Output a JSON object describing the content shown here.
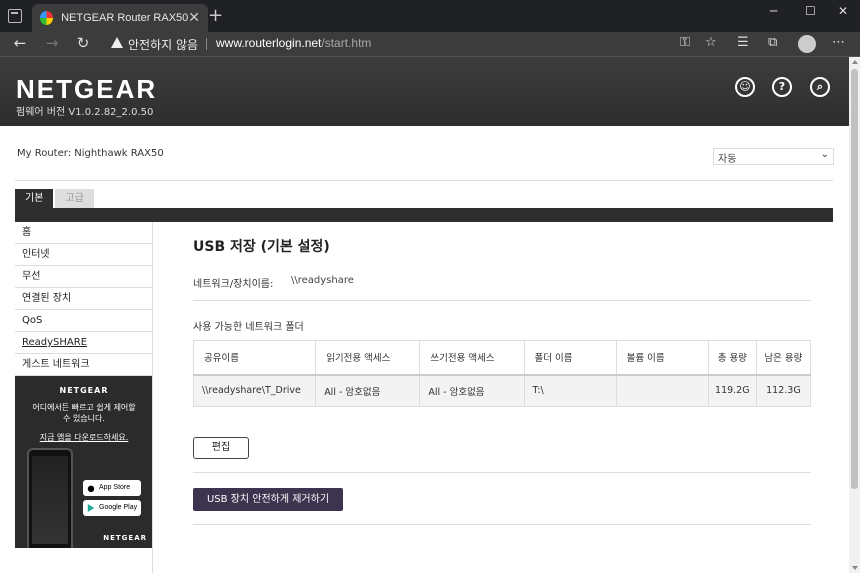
{
  "browser": {
    "tab_title": "NETGEAR Router RAX50",
    "security_warning": "안전하지 않음",
    "url_host": "www.routerlogin.net",
    "url_path": "/start.htm"
  },
  "header": {
    "logo": "NETGEAR",
    "firmware": "펌웨어 버전 V1.0.2.82_2.0.50"
  },
  "router": {
    "label": "My Router:",
    "name": "Nighthawk RAX50"
  },
  "language": {
    "selected": "자동"
  },
  "tabs": [
    {
      "label": "기본"
    },
    {
      "label": "고급"
    }
  ],
  "sidebar": {
    "items": [
      {
        "label": "홈"
      },
      {
        "label": "인터넷"
      },
      {
        "label": "무선"
      },
      {
        "label": "연결된 장치"
      },
      {
        "label": "QoS"
      },
      {
        "label": "ReadySHARE"
      },
      {
        "label": "게스트 네트워크"
      }
    ]
  },
  "promo": {
    "brand": "NETGEAR",
    "line1": "어디에서든 빠르고 쉽게 제어할",
    "line2": "수 있습니다.",
    "download": "지금 앱을 다운로드하세요.",
    "appstore_small": "Download on the",
    "appstore": "App Store",
    "googleplay_small": "GET IT ON",
    "googleplay": "Google Play",
    "footer": "NETGEAR"
  },
  "main": {
    "title": "USB 저장 (기본 설정)",
    "network_name_label": "네트워크/장치이름:",
    "network_name_value": "\\\\readyshare",
    "folders_title": "사용 가능한 네트워크 폴더",
    "columns": [
      "공유이름",
      "읽기전용 액세스",
      "쓰기전용 액세스",
      "폴더 이름",
      "볼륨 이름",
      "총 용량",
      "남은 용량"
    ],
    "rows": [
      [
        "\\\\readyshare\\T_Drive",
        "All - 암호없음",
        "All - 암호없음",
        "T:\\",
        "",
        "119.2G",
        "112.3G"
      ]
    ],
    "edit_button": "편집",
    "eject_button": "USB 장치 안전하게 제거하기"
  }
}
